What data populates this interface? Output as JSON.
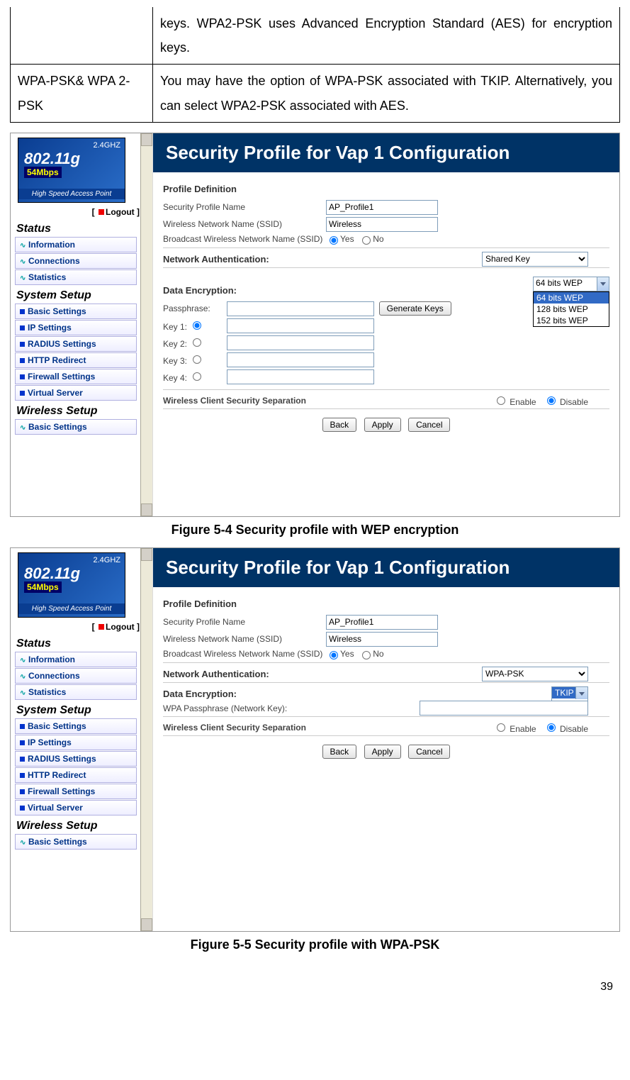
{
  "table": {
    "row1_right": "keys. WPA2-PSK uses Advanced Encryption Standard (AES) for encryption keys.",
    "row2_left": "WPA-PSK& WPA 2-PSK",
    "row2_right": "You may have the option of WPA-PSK associated with TKIP. Alternatively, you can select WPA2-PSK associated with AES."
  },
  "caption1": "Figure 5-4 Security profile with WEP encryption",
  "caption2": "Figure 5-5 Security profile with WPA-PSK",
  "logo": {
    "ghz": "2.4GHZ",
    "n": "802.11g",
    "mbps": "54Mbps",
    "hs": "High Speed Access Point"
  },
  "logout": {
    "open": "[",
    "close": "Logout ]"
  },
  "nav": {
    "status": "Status",
    "info": "Information",
    "conn": "Connections",
    "stats": "Statistics",
    "sys": "System Setup",
    "basic": "Basic Settings",
    "ip": "IP Settings",
    "radius": "RADIUS Settings",
    "http": "HTTP Redirect",
    "fw": "Firewall Settings",
    "vs": "Virtual Server",
    "wl": "Wireless Setup",
    "wbasic": "Basic Settings"
  },
  "header": "Security Profile for Vap 1 Configuration",
  "sections": {
    "profdef": "Profile Definition",
    "netauth": "Network Authentication:",
    "dataenc": "Data Encryption:",
    "wcss": "Wireless Client Security Separation"
  },
  "labels": {
    "spn": "Security Profile Name",
    "ssid": "Wireless Network Name (SSID)",
    "bssid": "Broadcast Wireless Network Name (SSID)",
    "pass": "Passphrase:",
    "k1": "Key 1:",
    "k2": "Key 2:",
    "k3": "Key 3:",
    "k4": "Key 4:",
    "wpapass": "WPA Passphrase (Network Key):",
    "yes": "Yes",
    "no": "No",
    "enable": "Enable",
    "disable": "Disable"
  },
  "values": {
    "spn": "AP_Profile1",
    "ssid": "Wireless"
  },
  "auth": {
    "shared": "Shared Key",
    "wpapsk": "WPA-PSK"
  },
  "enc": {
    "w64": "64 bits WEP",
    "w128": "128 bits WEP",
    "w152": "152 bits WEP",
    "tkip": "TKIP"
  },
  "buttons": {
    "gen": "Generate Keys",
    "back": "Back",
    "apply": "Apply",
    "cancel": "Cancel"
  },
  "page_num": "39"
}
